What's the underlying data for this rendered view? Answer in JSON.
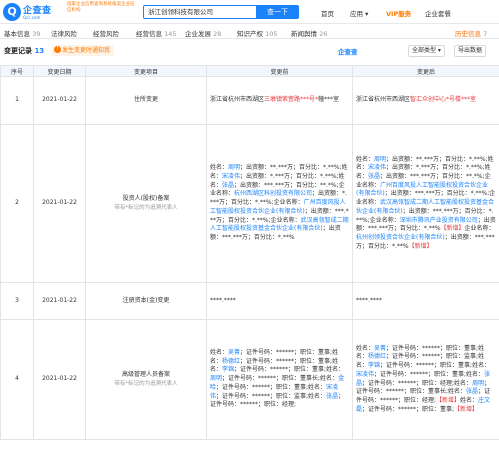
{
  "header": {
    "logo_char": "Q",
    "brand": "企查查",
    "brand_sub": "Qcc.com",
    "tagline": "国家企业信用查询系统备案企业征信机构",
    "search_value": "浙江创领科技有限公司",
    "search_button": "查一下",
    "nav": [
      "首页",
      "应用 ▾",
      "VIP服务",
      "企业套餐"
    ]
  },
  "tabs": [
    {
      "label": "基本信息",
      "count": "39",
      "highlight": false
    },
    {
      "label": "法律风险",
      "count": "",
      "highlight": false
    },
    {
      "label": "经营风险",
      "count": "",
      "highlight": false
    },
    {
      "label": "经营信息",
      "count": "145",
      "highlight": false
    },
    {
      "label": "企业发展",
      "count": "28",
      "highlight": false
    },
    {
      "label": "知识产权",
      "count": "105",
      "highnight": false
    },
    {
      "label": "新闻舆情",
      "count": "26",
      "highlight": false
    },
    {
      "label": "历史信息",
      "count": "7",
      "highlight": true
    }
  ],
  "section": {
    "title": "变更记录",
    "count": "13",
    "filter": "发生变更时通知我",
    "watermark": "企查查",
    "select": "全部类型 ▾",
    "export": "导出数据"
  },
  "table": {
    "headers": [
      "序号",
      "变更日期",
      "变更项目",
      "变更前",
      "变更后"
    ],
    "rows": [
      {
        "no": "1",
        "date": "2021-01-22",
        "item": "住所变更",
        "item_sub": "",
        "before": [
          [
            "浙江省杭州市西湖区",
            ""
          ],
          [
            "三墩镇紫萱路***号*",
            "red"
          ],
          [
            "幢***室",
            ""
          ]
        ],
        "after": [
          [
            "浙江省杭州市西湖区",
            ""
          ],
          [
            "智汇众创中心*号楼***室",
            "red"
          ]
        ]
      },
      {
        "no": "2",
        "date": "2021-01-22",
        "item": "投资人(股权)备案",
        "item_sub": "带有*标记的为追溯代表人",
        "before": [
          [
            "姓名：",
            ""
          ],
          [
            "周明",
            "blue"
          ],
          [
            "；出资额：**.***万；百分比：*.**%;",
            ""
          ],
          [
            "姓名：",
            ""
          ],
          [
            "宋凌伟",
            "blue"
          ],
          [
            "；出资额：*.***万；百分比：*.**%;",
            ""
          ],
          [
            "姓名：",
            ""
          ],
          [
            "张晶",
            "blue"
          ],
          [
            "；出资额：***.***万；百分比：**.*%;",
            ""
          ],
          [
            "企业名称：",
            ""
          ],
          [
            "杭州西湖区科创投资有限公司",
            "blue"
          ],
          [
            "；出资额：*.***万；百分比：*.**%;",
            ""
          ],
          [
            "企业名称：",
            ""
          ],
          [
            "广州百度风投人工智能股权投资合伙企业(有限合伙)",
            "blue"
          ],
          [
            "；出资额：***.***万；百分比：*.**%;",
            ""
          ],
          [
            "企业名称：",
            ""
          ],
          [
            "武汉高瓴智成二期人工智能股权投资基金合伙企业(有限合伙)",
            "blue"
          ],
          [
            "；出资额：***.***万；百分比：*.**%",
            ""
          ]
        ],
        "after": [
          [
            "姓名：",
            ""
          ],
          [
            "周明",
            "blue"
          ],
          [
            "；出资额：**.***万；百分比：*.**%;",
            ""
          ],
          [
            "姓名：",
            ""
          ],
          [
            "宋凌伟",
            "blue"
          ],
          [
            "；出资额：*.***万；百分比：*.**%;",
            ""
          ],
          [
            "姓名：",
            ""
          ],
          [
            "张晶",
            "blue"
          ],
          [
            "；出资额：***.***万；百分比：**.*%;",
            ""
          ],
          [
            "企业名称：",
            ""
          ],
          [
            "广州百度风投人工智能股权投资合伙企业(有限合伙)",
            "blue"
          ],
          [
            "；出资额：***.***万；百分比：*.**%;",
            ""
          ],
          [
            "企业名称：",
            ""
          ],
          [
            "武汉高瓴智成二期人工智能股权投资基金合伙企业(有限合伙)",
            "blue"
          ],
          [
            "；出资额：***.***万；百分比：*.**%;",
            ""
          ],
          [
            "企业名称：",
            ""
          ],
          [
            "深圳市腾讯产业投资有限公司",
            "blue"
          ],
          [
            "；出资额：***.***万；百分比：*.**%",
            ""
          ],
          [
            "【新增】",
            "red"
          ],
          [
            "企业名称：",
            ""
          ],
          [
            "杭州创领投资合伙企业(有限合伙)",
            "blue"
          ],
          [
            "；出资额：***.***万；百分比：*.**%",
            ""
          ],
          [
            "【新增】",
            "red"
          ]
        ]
      },
      {
        "no": "3",
        "date": "2021-01-22",
        "item": "注册资本(金)变更",
        "item_sub": "",
        "before": [
          [
            "****.****",
            ""
          ]
        ],
        "after": [
          [
            "****.****",
            ""
          ]
        ]
      },
      {
        "no": "4",
        "date": "2021-01-22",
        "item": "高级管理人员备案",
        "item_sub": "带有*标记的为追溯代表人",
        "before": [
          [
            "姓名：",
            ""
          ],
          [
            "吴菁",
            "blue"
          ],
          [
            "；证件号码：******；职位：董事;",
            ""
          ],
          [
            "姓名：",
            ""
          ],
          [
            "杨德红",
            "blue"
          ],
          [
            "；证件号码：******；职位：董事;",
            ""
          ],
          [
            "姓名：",
            ""
          ],
          [
            "李锦",
            "blue"
          ],
          [
            "；证件号码：******；职位：董事;",
            ""
          ],
          [
            "姓名：",
            ""
          ],
          [
            "周明",
            "blue"
          ],
          [
            "；证件号码：******；职位：董事长;",
            ""
          ],
          [
            "姓名：",
            ""
          ],
          [
            "金哈",
            "blue"
          ],
          [
            "；证件号码：******；职位：董事;",
            ""
          ],
          [
            "姓名：",
            ""
          ],
          [
            "宋凌伟",
            "blue"
          ],
          [
            "；证件号码：******；职位：监事;",
            ""
          ],
          [
            "姓名：",
            ""
          ],
          [
            "张晶",
            "blue"
          ],
          [
            "；证件号码：******；职位：经理;",
            ""
          ]
        ],
        "after": [
          [
            "姓名：",
            ""
          ],
          [
            "吴菁",
            "blue"
          ],
          [
            "；证件号码：******；职位：董事;",
            ""
          ],
          [
            "姓名：",
            ""
          ],
          [
            "杨德红",
            "blue"
          ],
          [
            "；证件号码：******；职位：监事;",
            ""
          ],
          [
            "姓名：",
            ""
          ],
          [
            "李锦",
            "blue"
          ],
          [
            "；证件号码：******；职位：董事;",
            ""
          ],
          [
            "姓名：",
            ""
          ],
          [
            "宋凌伟",
            "blue"
          ],
          [
            "；证件号码：******；职位：董事;",
            ""
          ],
          [
            "姓名：",
            ""
          ],
          [
            "张晶",
            "blue"
          ],
          [
            "；证件号码：******；职位：经理;",
            ""
          ],
          [
            "姓名：",
            ""
          ],
          [
            "周明",
            "blue"
          ],
          [
            "；证件号码：******；职位：董事长;",
            ""
          ],
          [
            "姓名：",
            ""
          ],
          [
            "张晶",
            "blue"
          ],
          [
            "；证件号码：******；职位：经理;",
            ""
          ],
          [
            "【新增】",
            "red"
          ],
          [
            "姓名：",
            ""
          ],
          [
            "庄文磊",
            "blue"
          ],
          [
            "；证件号码：******；职位：董事;",
            ""
          ],
          [
            "【新增】",
            "red"
          ]
        ]
      }
    ]
  }
}
